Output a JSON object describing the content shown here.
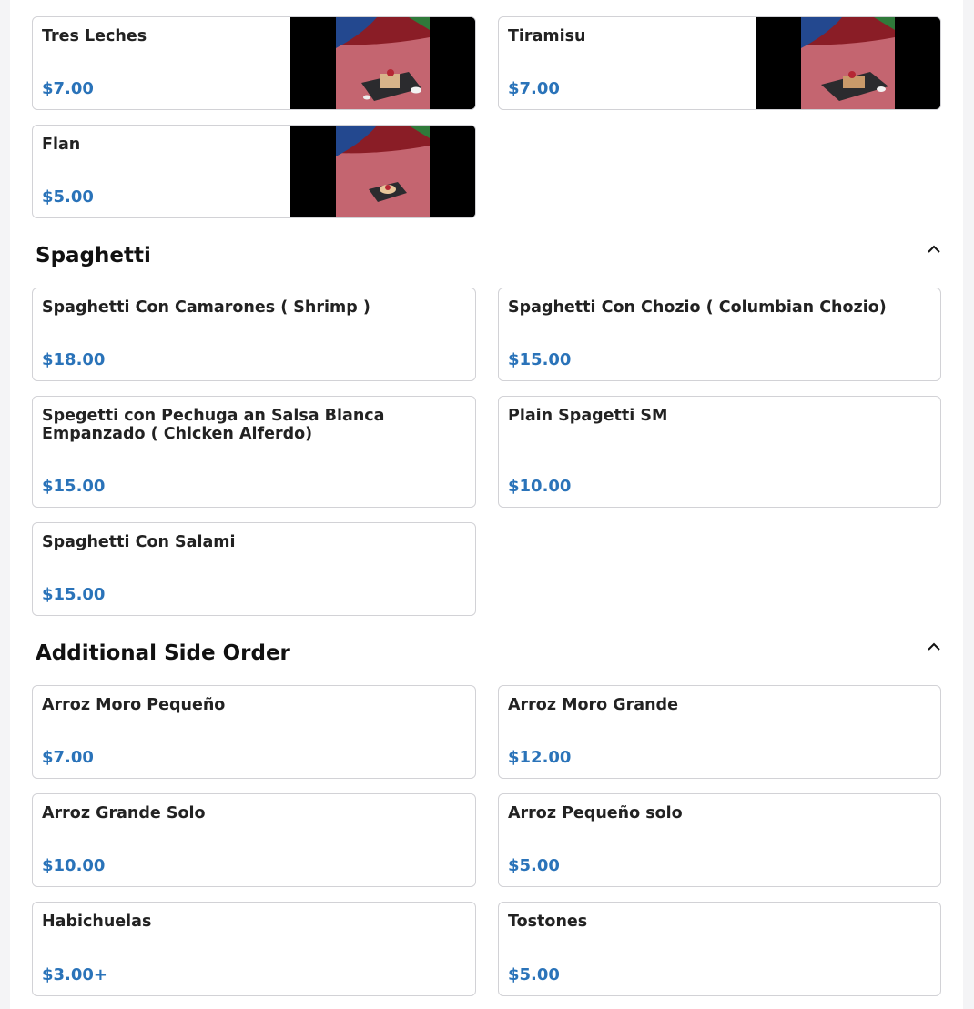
{
  "sections": [
    {
      "title": "",
      "items": [
        {
          "name": "Tres Leches",
          "price": "$7.00"
        },
        {
          "name": "Tiramisu",
          "price": "$7.00"
        },
        {
          "name": "Flan",
          "price": "$5.00"
        }
      ]
    },
    {
      "title": "Spaghetti",
      "collapse_icon": "chevron-up-icon",
      "items": [
        {
          "name": "Spaghetti Con Camarones ( Shrimp )",
          "price": "$18.00"
        },
        {
          "name": "Spaghetti Con Chozio ( Columbian Chozio)",
          "price": "$15.00"
        },
        {
          "name": "Spegetti con Pechuga an Salsa Blanca Empanzado ( Chicken Alferdo)",
          "price": "$15.00"
        },
        {
          "name": "Plain Spagetti SM",
          "price": "$10.00"
        },
        {
          "name": "Spaghetti Con Salami",
          "price": "$15.00"
        }
      ]
    },
    {
      "title": "Additional Side Order",
      "collapse_icon": "chevron-up-icon",
      "items": [
        {
          "name": "Arroz Moro Pequeño",
          "price": "$7.00"
        },
        {
          "name": "Arroz Moro Grande",
          "price": "$12.00"
        },
        {
          "name": "Arroz Grande Solo",
          "price": "$10.00"
        },
        {
          "name": "Arroz Pequeño solo",
          "price": "$5.00"
        },
        {
          "name": "Habichuelas",
          "price": "$3.00+"
        },
        {
          "name": "Tostones",
          "price": "$5.00"
        }
      ]
    }
  ],
  "colors": {
    "price": "#2a73b9",
    "card_border": "#d2d2d6",
    "page_background": "#f4f4f6"
  }
}
